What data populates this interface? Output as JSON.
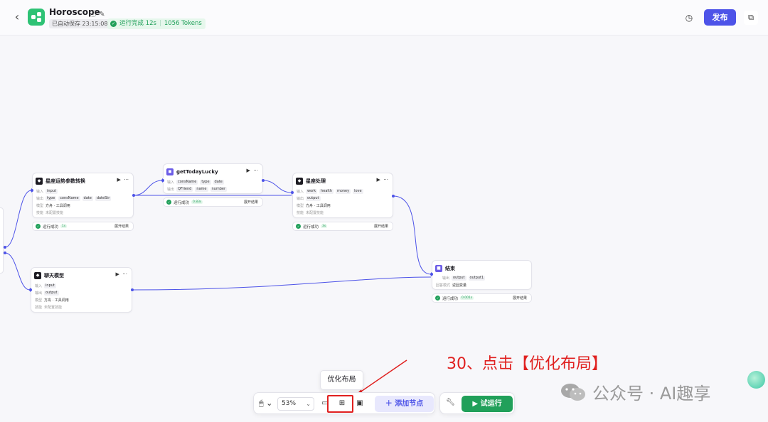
{
  "header": {
    "title": "Horoscope",
    "saved_text": "已自动保存 23:15:08",
    "run_status": "运行完成 12s",
    "run_tokens": "1056 Tokens",
    "publish_label": "发布",
    "back_icon": "chevron-left-icon",
    "history_icon": "history-icon",
    "copy_icon": "copy-icon"
  },
  "nodes": {
    "convert": {
      "title": "星座运势参数转换",
      "input_label": "输入",
      "input_tags": [
        "input"
      ],
      "output_label": "输出",
      "output_tags": [
        "type",
        "consName",
        "date",
        "dateStr"
      ],
      "model_label": "模型",
      "model_value": "方舟 · 工具调用",
      "skill_label": "技能",
      "skill_value": "未配置技能",
      "result_label": "运行成功",
      "result_time": "1s",
      "expand_label": "展开结果"
    },
    "lucky": {
      "title": "getTodayLucky",
      "input_label": "输入",
      "input_tags": [
        "consName",
        "type",
        "date"
      ],
      "output_label": "输出",
      "output_tags": [
        "QFriend",
        "name",
        "number"
      ],
      "result_label": "运行成功",
      "result_time": "0.83s",
      "expand_label": "展开结果"
    },
    "process": {
      "title": "星座处理",
      "input_label": "输入",
      "input_tags": [
        "work",
        "health",
        "money",
        "love"
      ],
      "output_label": "输出",
      "output_tags": [
        "output"
      ],
      "model_label": "模型",
      "model_value": "方舟 · 工具调用",
      "skill_label": "技能",
      "skill_value": "未配置技能",
      "result_label": "运行成功",
      "result_time": "3s",
      "expand_label": "展开结果"
    },
    "chat": {
      "title": "聊天模型",
      "input_label": "输入",
      "input_tags": [
        "input"
      ],
      "output_label": "输出",
      "output_tags": [
        "output"
      ],
      "model_label": "模型",
      "model_value": "方舟 · 工具调用",
      "skill_label": "技能",
      "skill_value": "未配置技能"
    },
    "end": {
      "title": "结束",
      "output_label": "输出",
      "output_tags": [
        "output",
        "output1"
      ],
      "mode_label": "回答模式",
      "mode_value": "返回变量",
      "result_label": "运行成功",
      "result_time": "0.001s",
      "expand_label": "展开结果"
    }
  },
  "toolbar": {
    "zoom": "53%",
    "tooltip": "优化布局",
    "add_node_label": "添加节点",
    "test_run_label": "试运行"
  },
  "annotation": "30、点击【优化布局】",
  "watermark": "公众号 · AI趣享",
  "colors": {
    "accent": "#4d53e8",
    "success": "#21a05a",
    "annotation": "#e0201f"
  }
}
